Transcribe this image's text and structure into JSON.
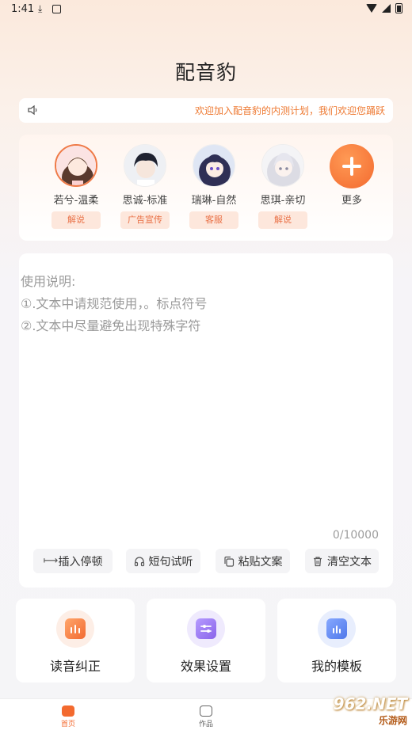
{
  "status": {
    "time": "1:41"
  },
  "app": {
    "title": "配音豹"
  },
  "notice": {
    "text": "欢迎加入配音豹的内测计划，我们欢迎您踊跃"
  },
  "voices": [
    {
      "name": "若兮-温柔",
      "tag": "解说",
      "selected": true
    },
    {
      "name": "思诚-标准",
      "tag": "广告宣传",
      "selected": false
    },
    {
      "name": "瑞琳-自然",
      "tag": "客服",
      "selected": false
    },
    {
      "name": "思琪-亲切",
      "tag": "解说",
      "selected": false
    }
  ],
  "more": {
    "label": "更多"
  },
  "editor": {
    "placeholder_lines": [
      "使用说明:",
      "①.文本中请规范使用，。标点符号",
      "②.文本中尽量避免出现特殊字符"
    ],
    "counter": "0/10000"
  },
  "tools": [
    {
      "label": "插入停顿",
      "icon": "pause-insert-icon"
    },
    {
      "label": "短句试听",
      "icon": "headphones-icon"
    },
    {
      "label": "粘贴文案",
      "icon": "copy-icon"
    },
    {
      "label": "清空文本",
      "icon": "trash-icon"
    }
  ],
  "cards": [
    {
      "label": "读音纠正",
      "icon": "pronunciation-icon",
      "color": "#f5874a"
    },
    {
      "label": "效果设置",
      "icon": "sliders-icon",
      "color": "#9b7af0"
    },
    {
      "label": "我的模板",
      "icon": "template-icon",
      "color": "#5b86ef"
    }
  ],
  "tabs": [
    {
      "label": "首页",
      "active": true,
      "color": "#f36a2f"
    },
    {
      "label": "作品",
      "active": false,
      "color": "#666666"
    }
  ],
  "watermark": {
    "main": "962.NET",
    "sub": "乐游网"
  }
}
